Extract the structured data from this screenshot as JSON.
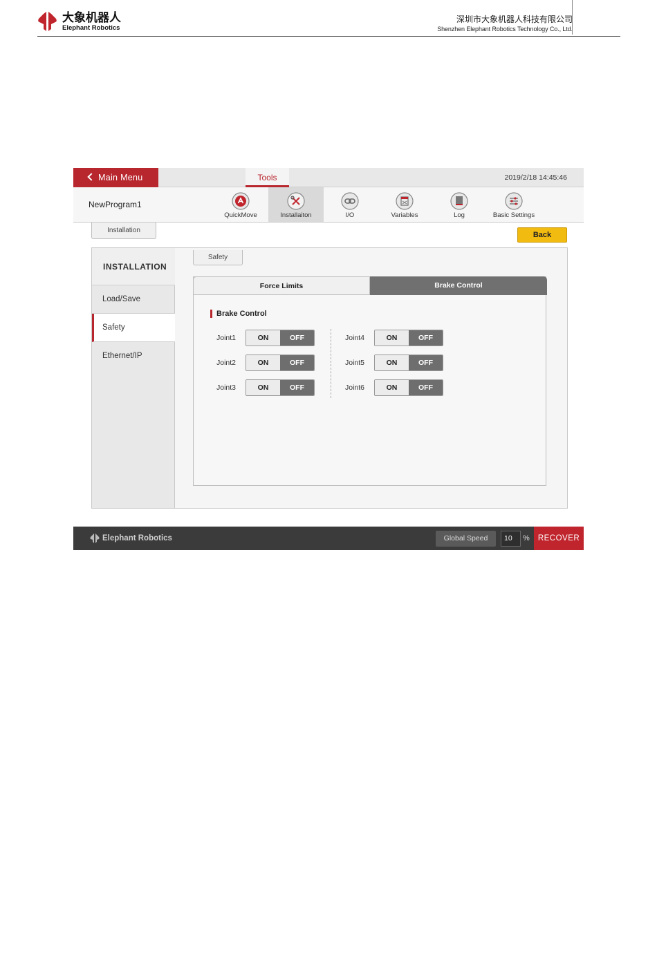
{
  "doc_header": {
    "logo_cn": "大象机器人",
    "logo_en": "Elephant Robotics",
    "company_cn": "深圳市大象机器人科技有限公司",
    "company_en": "Shenzhen Elephant Robotics Technology Co., Ltd."
  },
  "colors": {
    "brand_red": "#b8262e",
    "back_yellow": "#f2bb10",
    "off_gray": "#6e6e6e",
    "footer_dark": "#3b3b3b"
  },
  "topbar": {
    "main_menu_label": "Main Menu",
    "active_tab": "Tools",
    "datetime": "2019/2/18 14:45:46"
  },
  "toolbar": {
    "program_name": "NewProgram1",
    "items": [
      {
        "label": "QuickMove",
        "icon": "quickmove-icon"
      },
      {
        "label": "Installaiton",
        "icon": "tools-icon"
      },
      {
        "label": "I/O",
        "icon": "io-icon"
      },
      {
        "label": "Variables",
        "icon": "variables-icon"
      },
      {
        "label": "Log",
        "icon": "log-icon"
      },
      {
        "label": "Basic Settings",
        "icon": "settings-sliders-icon"
      }
    ]
  },
  "installation_tab": "Installation",
  "back_label": "Back",
  "sidebar": {
    "title": "INSTALLATION",
    "items": [
      {
        "label": "Load/Save"
      },
      {
        "label": "Safety"
      },
      {
        "label": "Ethernet/IP"
      }
    ]
  },
  "safety_tab": "Safety",
  "segments": {
    "left": "Force Limits",
    "right": "Brake Control"
  },
  "brake": {
    "title": "Brake Control",
    "on_label": "ON",
    "off_label": "OFF",
    "joints": [
      {
        "label": "Joint1",
        "state": "OFF"
      },
      {
        "label": "Joint2",
        "state": "OFF"
      },
      {
        "label": "Joint3",
        "state": "OFF"
      },
      {
        "label": "Joint4",
        "state": "OFF"
      },
      {
        "label": "Joint5",
        "state": "OFF"
      },
      {
        "label": "Joint6",
        "state": "OFF"
      }
    ]
  },
  "footer": {
    "brand": "Elephant Robotics",
    "global_speed_label": "Global Speed",
    "global_speed_value": "10",
    "unit": "%",
    "recover_label": "RECOVER"
  }
}
